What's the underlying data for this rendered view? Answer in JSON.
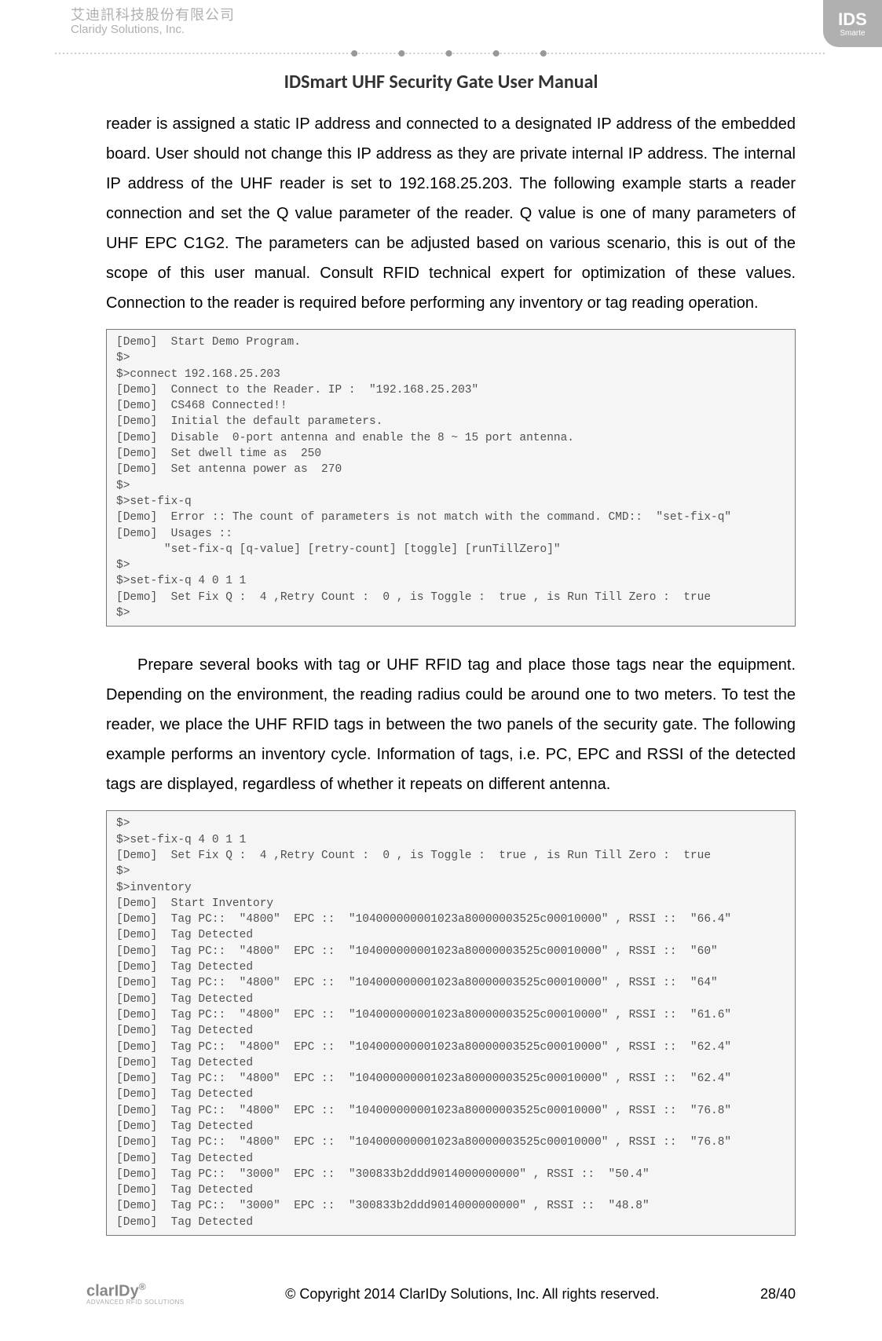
{
  "header": {
    "company_cn": "艾迪訊科技股份有限公司",
    "company_en": "Claridy Solutions, Inc.",
    "badge_main": "IDS",
    "badge_sub": "Smarte"
  },
  "doc_title": "IDSmart UHF Security Gate User Manual",
  "para1": "reader is assigned a static IP address and connected to a designated IP address of the embedded board. User should not change this IP address as they are private internal IP address. The internal IP address of the UHF reader is set to 192.168.25.203. The following example starts a reader connection and set the Q value parameter of the reader. Q value is one of many parameters of UHF EPC C1G2. The parameters can be adjusted based on various scenario, this is out of the scope of this user manual. Consult RFID technical expert for optimization of these values. Connection to the reader is required before performing any inventory or tag reading operation.",
  "code1": "[Demo]  Start Demo Program.\n$>\n$>connect 192.168.25.203\n[Demo]  Connect to the Reader. IP :  \"192.168.25.203\"\n[Demo]  CS468 Connected!!\n[Demo]  Initial the default parameters.\n[Demo]  Disable  0-port antenna and enable the 8 ~ 15 port antenna.\n[Demo]  Set dwell time as  250\n[Demo]  Set antenna power as  270\n$>\n$>set-fix-q\n[Demo]  Error :: The count of parameters is not match with the command. CMD::  \"set-fix-q\"\n[Demo]  Usages ::\n       \"set-fix-q [q-value] [retry-count] [toggle] [runTillZero]\"\n$>\n$>set-fix-q 4 0 1 1\n[Demo]  Set Fix Q :  4 ,Retry Count :  0 , is Toggle :  true , is Run Till Zero :  true\n$>",
  "para2": "Prepare several books with tag or UHF RFID tag and place those tags near the equipment. Depending on the environment, the reading radius could be around one to two meters. To test the reader, we place the UHF RFID tags in between the two panels of the security gate. The following example performs an inventory cycle. Information of tags, i.e. PC, EPC and RSSI of the detected tags are displayed, regardless of whether it repeats on different antenna.",
  "code2": "$>\n$>set-fix-q 4 0 1 1\n[Demo]  Set Fix Q :  4 ,Retry Count :  0 , is Toggle :  true , is Run Till Zero :  true\n$>\n$>inventory\n[Demo]  Start Inventory\n[Demo]  Tag PC::  \"4800\"  EPC ::  \"104000000001023a80000003525c00010000\" , RSSI ::  \"66.4\"\n[Demo]  Tag Detected\n[Demo]  Tag PC::  \"4800\"  EPC ::  \"104000000001023a80000003525c00010000\" , RSSI ::  \"60\"\n[Demo]  Tag Detected\n[Demo]  Tag PC::  \"4800\"  EPC ::  \"104000000001023a80000003525c00010000\" , RSSI ::  \"64\"\n[Demo]  Tag Detected\n[Demo]  Tag PC::  \"4800\"  EPC ::  \"104000000001023a80000003525c00010000\" , RSSI ::  \"61.6\"\n[Demo]  Tag Detected\n[Demo]  Tag PC::  \"4800\"  EPC ::  \"104000000001023a80000003525c00010000\" , RSSI ::  \"62.4\"\n[Demo]  Tag Detected\n[Demo]  Tag PC::  \"4800\"  EPC ::  \"104000000001023a80000003525c00010000\" , RSSI ::  \"62.4\"\n[Demo]  Tag Detected\n[Demo]  Tag PC::  \"4800\"  EPC ::  \"104000000001023a80000003525c00010000\" , RSSI ::  \"76.8\"\n[Demo]  Tag Detected\n[Demo]  Tag PC::  \"4800\"  EPC ::  \"104000000001023a80000003525c00010000\" , RSSI ::  \"76.8\"\n[Demo]  Tag Detected\n[Demo]  Tag PC::  \"3000\"  EPC ::  \"300833b2ddd9014000000000\" , RSSI ::  \"50.4\"\n[Demo]  Tag Detected\n[Demo]  Tag PC::  \"3000\"  EPC ::  \"300833b2ddd9014000000000\" , RSSI ::  \"48.8\"\n[Demo]  Tag Detected",
  "footer": {
    "logo_text": "clarIDy",
    "logo_reg": "®",
    "logo_tag": "ADVANCED RFID SOLUTIONS",
    "copyright": "© Copyright 2014 ClarIDy Solutions, Inc. All rights reserved.",
    "pagenum": "28/40"
  }
}
